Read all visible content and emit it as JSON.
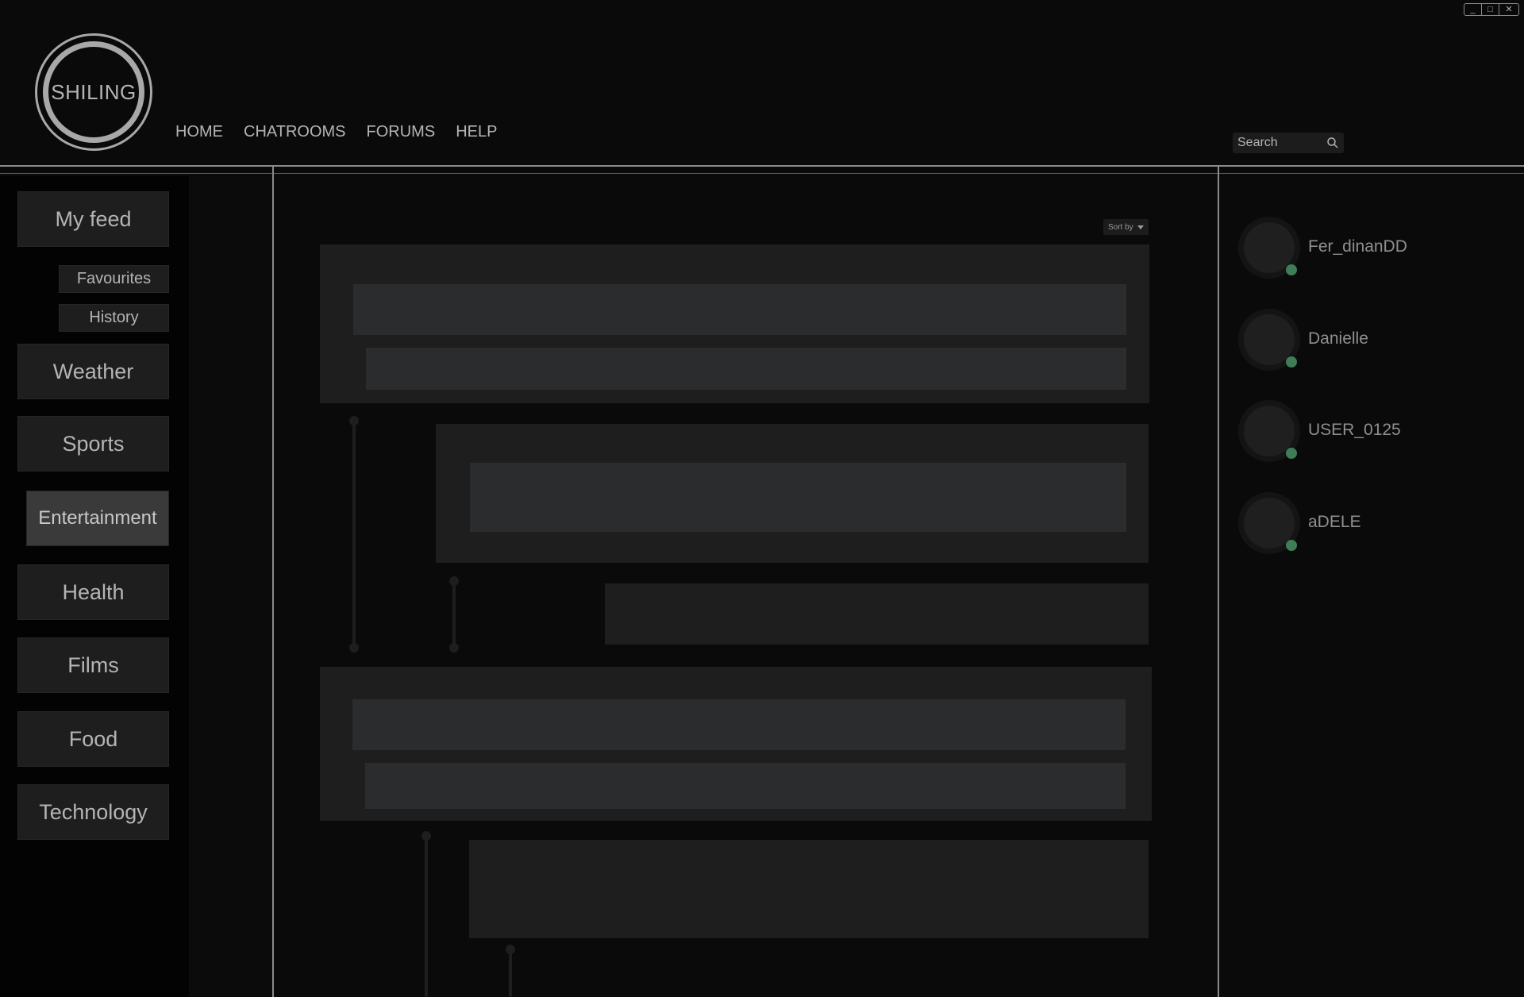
{
  "window": {
    "controls": {
      "minimize": "_",
      "maximize": "□",
      "close": "✕"
    }
  },
  "header": {
    "logo_text": "SHILING",
    "nav": [
      "HOME",
      "CHATROOMS",
      "FORUMS",
      "HELP"
    ],
    "search_placeholder": "Search"
  },
  "sidebar": {
    "my_feed": "My feed",
    "sub_items": [
      "Favourites",
      "History"
    ],
    "categories": [
      "Weather",
      "Sports",
      "Entertainment",
      "Health",
      "Films",
      "Food",
      "Technology"
    ],
    "active_category": "Entertainment"
  },
  "feed": {
    "sort_label": "Sort by"
  },
  "users": [
    {
      "name": "Fer_dinanDD",
      "online": true
    },
    {
      "name": "Danielle",
      "online": true
    },
    {
      "name": "USER_0125",
      "online": true
    },
    {
      "name": "aDELE",
      "online": true
    }
  ],
  "colors": {
    "online": "#3e7d56",
    "background": "#0a0a0a",
    "panel": "#1f1e1f"
  }
}
